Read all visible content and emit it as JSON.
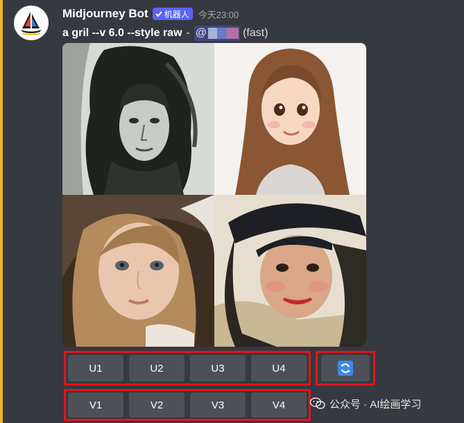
{
  "message": {
    "author": "Midjourney Bot",
    "badge": "机器人",
    "timestamp": "今天23:00",
    "prompt": "a gril --v 6.0 --style raw",
    "separator": "-",
    "mention": "@",
    "speed": "(fast)"
  },
  "image_grid": {
    "tiles": [
      {
        "style": "dark charcoal sketch portrait"
      },
      {
        "style": "cartoon girl with long brown hair"
      },
      {
        "style": "photorealistic child portrait"
      },
      {
        "style": "painterly woman in hat"
      }
    ]
  },
  "buttons": {
    "upscale": [
      "U1",
      "U2",
      "U3",
      "U4"
    ],
    "variation": [
      "V1",
      "V2",
      "V3",
      "V4"
    ],
    "reroll_icon": "refresh-icon"
  },
  "watermark": {
    "text": "公众号 · AI绘画学习"
  },
  "colors": {
    "background": "#36393f",
    "accent_bar": "#f0b232",
    "button": "#4e5058",
    "highlight_box": "#e3141b",
    "badge": "#5865f2",
    "refresh": "#3b8be5"
  }
}
